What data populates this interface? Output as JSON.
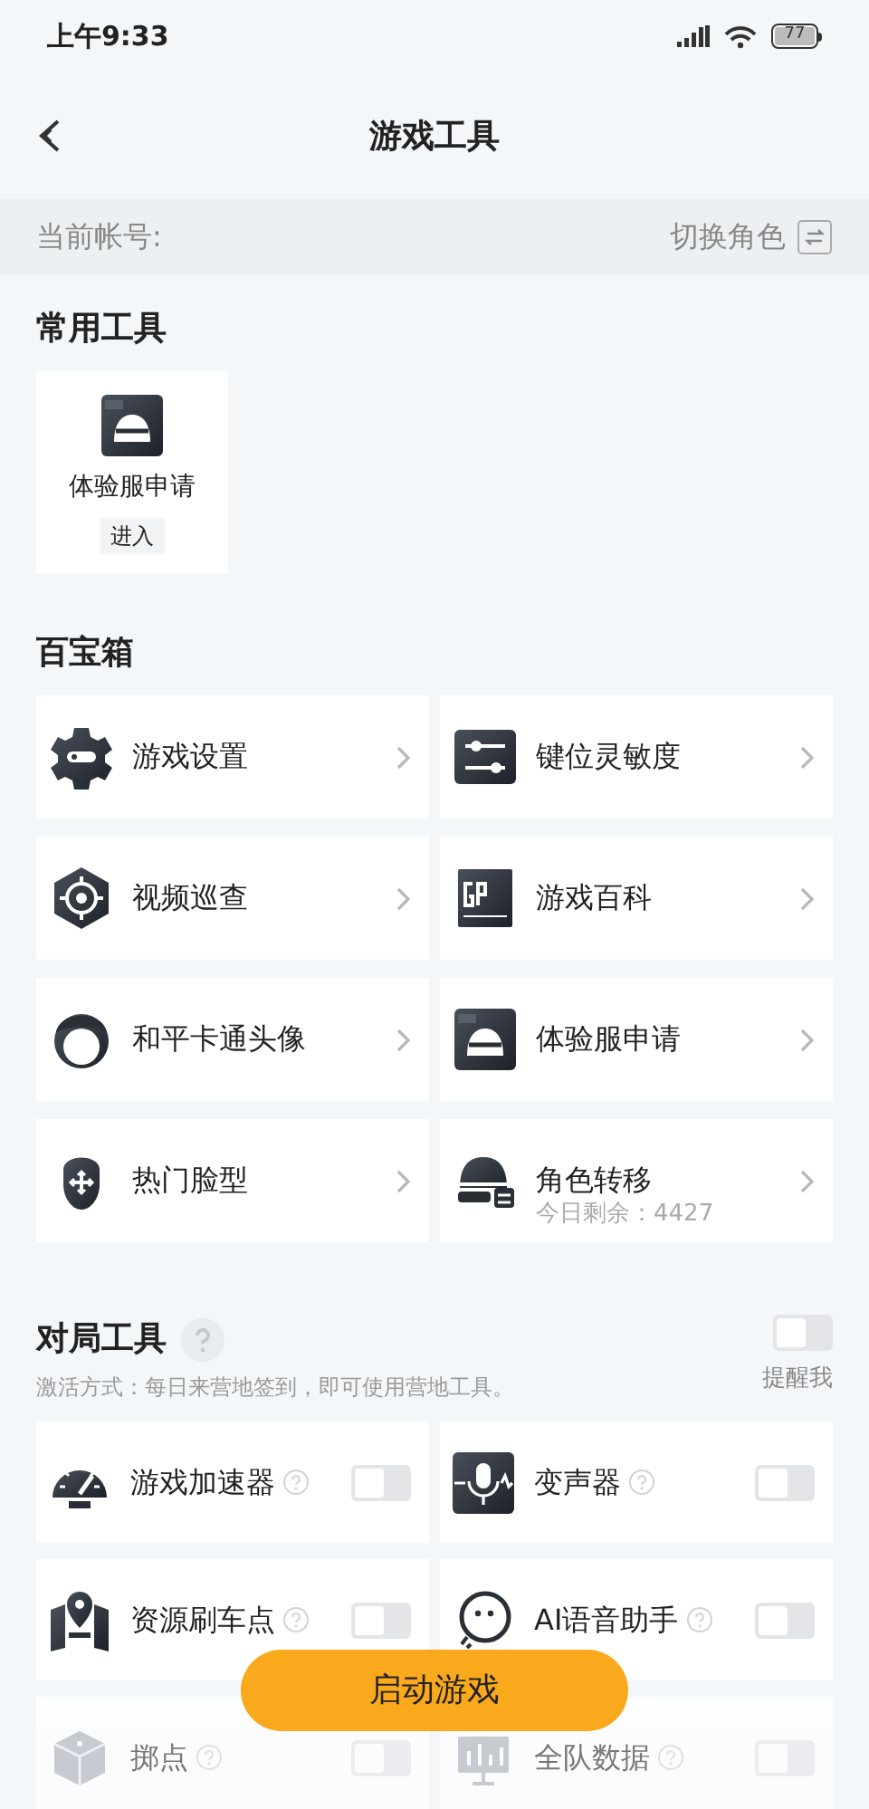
{
  "status_bar": {
    "time": "上午9:33",
    "battery": "77"
  },
  "header": {
    "title": "游戏工具"
  },
  "account": {
    "label": "当前帐号:",
    "switch_label": "切换角色"
  },
  "common_tools": {
    "title": "常用工具",
    "items": [
      {
        "label": "体验服申请",
        "action": "进入"
      }
    ]
  },
  "toolbox": {
    "title": "百宝箱",
    "items": [
      {
        "label": "游戏设置"
      },
      {
        "label": "键位灵敏度"
      },
      {
        "label": "视频巡查"
      },
      {
        "label": "游戏百科"
      },
      {
        "label": "和平卡通头像"
      },
      {
        "label": "体验服申请"
      },
      {
        "label": "热门脸型"
      },
      {
        "label": "角色转移",
        "subtitle": "今日剩余：4427"
      }
    ]
  },
  "match_tools": {
    "title": "对局工具",
    "hint": "激活方式：每日来营地签到，即可使用营地工具。",
    "remind": {
      "label": "提醒我",
      "on": false
    },
    "items": [
      {
        "label": "游戏加速器",
        "on": false
      },
      {
        "label": "变声器",
        "on": false
      },
      {
        "label": "资源刷车点",
        "on": false
      },
      {
        "label": "AI语音助手",
        "on": false
      },
      {
        "label": "掷点",
        "on": false
      },
      {
        "label": "全队数据",
        "on": false
      }
    ]
  },
  "start_button": "启动游戏"
}
